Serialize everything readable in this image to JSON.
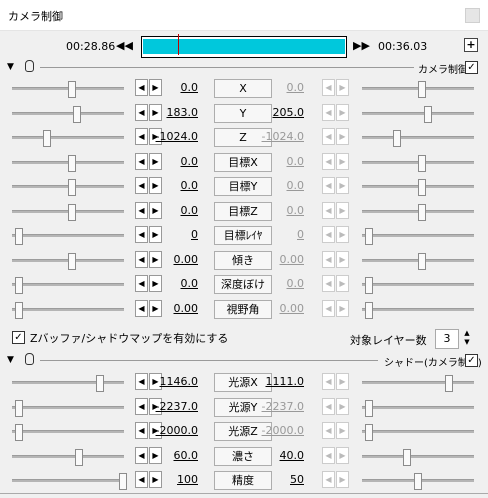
{
  "window": {
    "title": "カメラ制御"
  },
  "timeline": {
    "start_time": "00:28.86",
    "end_time": "00:36.03",
    "prev_icon": "skip-back-icon",
    "next_icon": "skip-forward-icon",
    "add_label": "+"
  },
  "camera": {
    "section_label": "カメラ制御",
    "enabled": true,
    "params": [
      {
        "name": "X",
        "value": "0.0",
        "end": "0.0",
        "left": 0.54,
        "right": 0.54
      },
      {
        "name": "Y",
        "value": "183.0",
        "end": "205.0",
        "left": 0.58,
        "right": 0.59
      },
      {
        "name": "Z",
        "value": "-1024.0",
        "end": "-1024.0",
        "left": 0.31,
        "right": 0.31
      },
      {
        "name": "目標X",
        "value": "0.0",
        "end": "0.0",
        "left": 0.54,
        "right": 0.54
      },
      {
        "name": "目標Y",
        "value": "0.0",
        "end": "0.0",
        "left": 0.54,
        "right": 0.54
      },
      {
        "name": "目標Z",
        "value": "0.0",
        "end": "0.0",
        "left": 0.54,
        "right": 0.54
      },
      {
        "name": "目標ﾚｲﾔ",
        "value": "0",
        "end": "0",
        "left": 0.06,
        "right": 0.06
      },
      {
        "name": "傾き",
        "value": "0.00",
        "end": "0.00",
        "left": 0.54,
        "right": 0.54
      },
      {
        "name": "深度ぼけ",
        "value": "0.0",
        "end": "0.0",
        "left": 0.06,
        "right": 0.06
      },
      {
        "name": "視野角",
        "value": "0.00",
        "end": "0.00",
        "left": 0.06,
        "right": 0.06
      }
    ],
    "zbuffer_label": "Zバッファ/シャドウマップを有効にする",
    "zbuffer_checked": true,
    "layer_count_label": "対象レイヤー数",
    "layer_count": "3"
  },
  "shadow": {
    "section_label": "シャドー(カメラ制御)",
    "enabled": true,
    "params": [
      {
        "name": "光源X",
        "value": "1146.0",
        "end": "1111.0",
        "left": 0.79,
        "right": 0.78
      },
      {
        "name": "光源Y",
        "value": "-2237.0",
        "end": "-2237.0",
        "left": 0.06,
        "right": 0.06
      },
      {
        "name": "光源Z",
        "value": "-2000.0",
        "end": "-2000.0",
        "left": 0.06,
        "right": 0.06
      },
      {
        "name": "濃さ",
        "value": "60.0",
        "end": "40.0",
        "left": 0.6,
        "right": 0.4
      },
      {
        "name": "精度",
        "value": "100",
        "end": "50",
        "left": 0.99,
        "right": 0.5
      }
    ]
  }
}
